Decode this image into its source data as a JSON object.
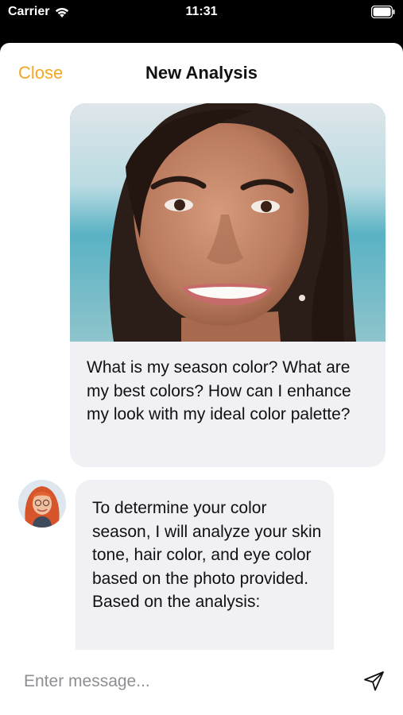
{
  "status_bar": {
    "carrier": "Carrier",
    "time": "11:31",
    "icons": [
      "wifi-icon",
      "battery-icon"
    ]
  },
  "nav": {
    "close_label": "Close",
    "title": "New Analysis"
  },
  "messages": [
    {
      "role": "user",
      "image": "portrait-photo",
      "text": "What is my season color? What are my best colors? How can I enhance my look with my ideal color palette?"
    },
    {
      "role": "assistant",
      "avatar": "assistant-avatar",
      "text": "To determine your color season, I will analyze your skin tone, hair color, and eye color based on the photo provided. Based on the analysis:"
    }
  ],
  "composer": {
    "placeholder": "Enter message...",
    "value": "",
    "send_icon": "send-icon"
  },
  "colors": {
    "accent": "#F5A623",
    "bubble": "#F0F0F5",
    "background": "#FFFFFF",
    "status_bar": "#000000"
  }
}
